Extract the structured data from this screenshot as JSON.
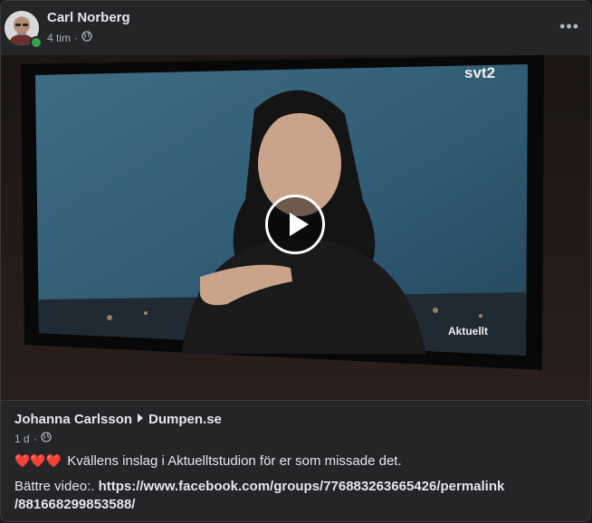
{
  "post": {
    "author": "Carl Norberg",
    "time": "4 tim",
    "privacy_icon": "globe-icon",
    "more_icon": "more-icon"
  },
  "video": {
    "channel_logo": "svt2",
    "program_tag": "Aktuellt",
    "play_icon": "play-icon"
  },
  "shared": {
    "author": "Johanna Carlsson",
    "group": "Dumpen.se",
    "time": "1 d",
    "hearts": "❤️❤️❤️",
    "caption": "Kvällens inslag i Aktuelltstudion för er som missade det.",
    "better_label": "Bättre video:.",
    "link_part1": "https://www.facebook.com/groups/776883263665426/permalink",
    "link_part2": "/881668299853588/"
  },
  "colors": {
    "background": "#242526",
    "text": "#e4e6eb",
    "secondary": "#b0b3b8",
    "online": "#31a24c",
    "heart": "#e0245e"
  }
}
